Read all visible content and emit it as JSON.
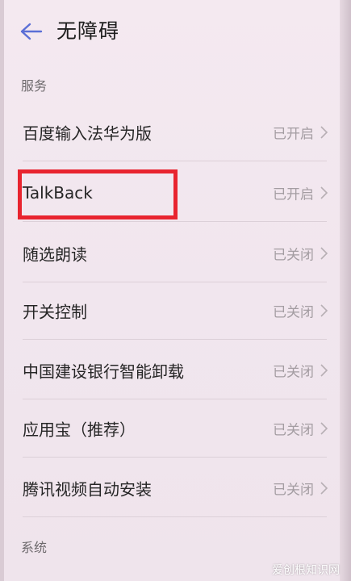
{
  "header": {
    "title": "无障碍"
  },
  "sections": {
    "services": "服务",
    "system": "系统"
  },
  "rows": [
    {
      "label": "百度输入法华为版",
      "status": "已开启"
    },
    {
      "label": "TalkBack",
      "status": "已开启"
    },
    {
      "label": "随选朗读",
      "status": "已关闭"
    },
    {
      "label": "开关控制",
      "status": "已关闭"
    },
    {
      "label": "中国建设银行智能卸载",
      "status": "已关闭"
    },
    {
      "label": "应用宝（推荐）",
      "status": "已关闭"
    },
    {
      "label": "腾讯视频自动安装",
      "status": "已关闭"
    }
  ],
  "colors": {
    "highlight": "#e8242f",
    "accent": "#5b6fd6"
  },
  "icons": {
    "back": "back-arrow-icon",
    "chevron": "chevron-right-icon"
  },
  "watermark": "爱创根知识网"
}
